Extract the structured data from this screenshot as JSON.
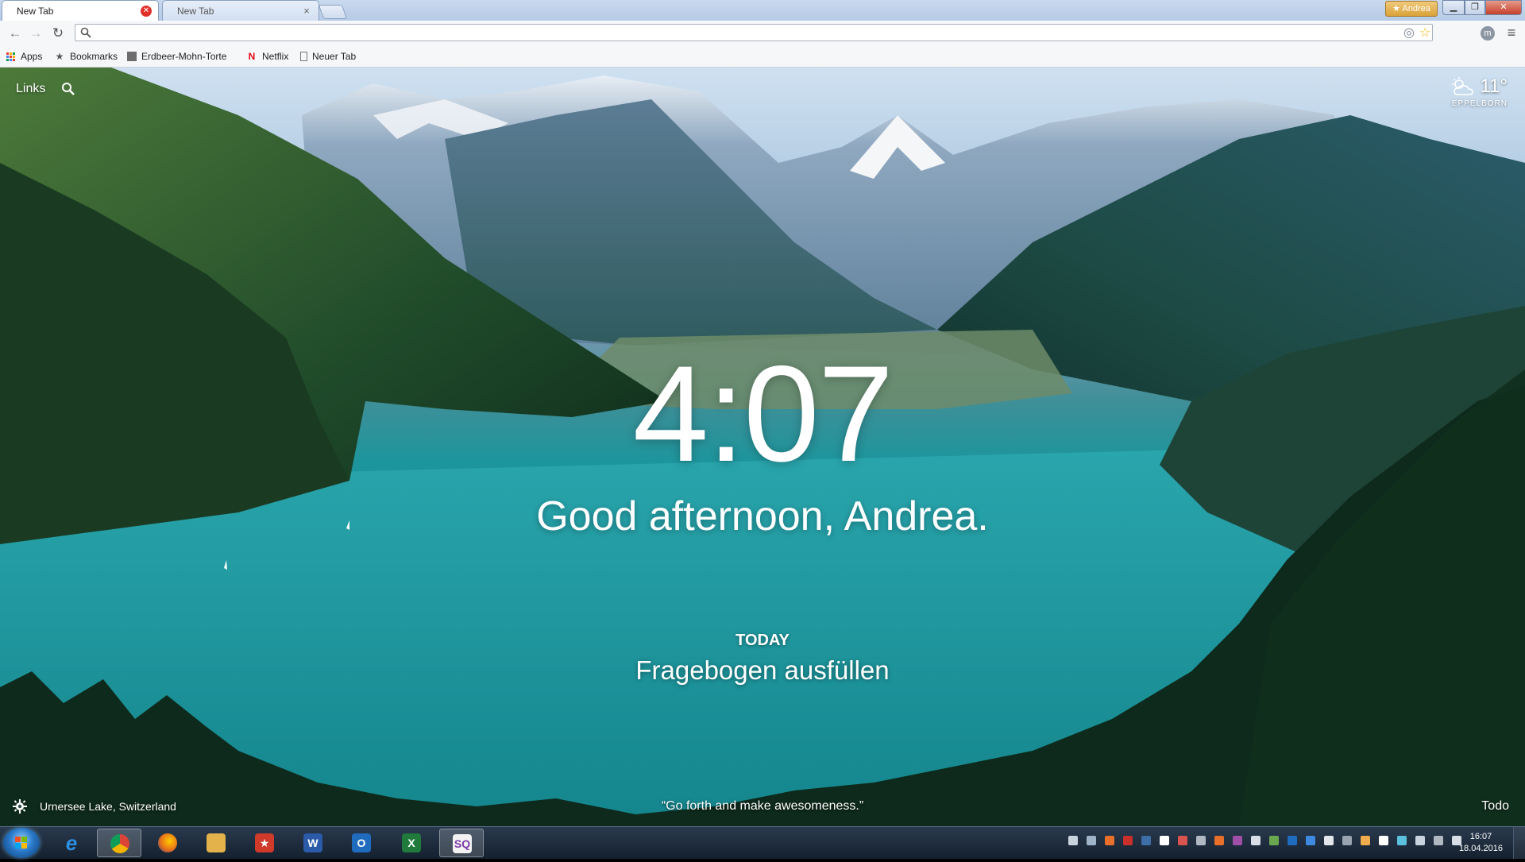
{
  "browser": {
    "tabs": [
      {
        "title": "New Tab",
        "active": true
      },
      {
        "title": "New Tab",
        "active": false
      }
    ],
    "profile_name": "Andrea",
    "omnibox": {
      "value": "",
      "placeholder": ""
    },
    "bookmarks": [
      {
        "label": "Apps",
        "icon": "apps-grid-icon"
      },
      {
        "label": "Bookmarks",
        "icon": "star-icon"
      },
      {
        "label": "Erdbeer-Mohn-Torte",
        "icon": "page-icon"
      },
      {
        "label": "Netflix",
        "icon": "netflix-icon"
      },
      {
        "label": "Neuer Tab",
        "icon": "document-icon"
      }
    ]
  },
  "momentum": {
    "links_label": "Links",
    "weather": {
      "temperature": "11°",
      "location": "EPPELBORN",
      "icon": "partly-cloudy-icon"
    },
    "clock": "4:07",
    "greeting": "Good afternoon, Andrea.",
    "focus_label": "TODAY",
    "focus_text": "Fragebogen ausfüllen",
    "photo_location": "Urnersee Lake, Switzerland",
    "quote": "“Go forth and make awesomeness.”",
    "todo_label": "Todo"
  },
  "taskbar": {
    "apps": [
      {
        "name": "internet-explorer",
        "icon": "ie-icon",
        "color": "#2d8ee0",
        "glyph": "e"
      },
      {
        "name": "chrome",
        "icon": "chrome-icon",
        "color": "#d84a38",
        "glyph": ""
      },
      {
        "name": "firefox",
        "icon": "firefox-icon",
        "color": "#e8701a",
        "glyph": ""
      },
      {
        "name": "file-explorer",
        "icon": "folder-icon",
        "color": "#e3b24a",
        "glyph": ""
      },
      {
        "name": "wunderlist",
        "icon": "wunderlist-icon",
        "color": "#cf3a2a",
        "glyph": "★"
      },
      {
        "name": "word",
        "icon": "word-icon",
        "color": "#2a5aa8",
        "glyph": "W"
      },
      {
        "name": "outlook",
        "icon": "outlook-icon",
        "color": "#1f6cbf",
        "glyph": "O"
      },
      {
        "name": "excel",
        "icon": "excel-icon",
        "color": "#1f7a3c",
        "glyph": "X"
      },
      {
        "name": "sq-app",
        "icon": "sq-icon",
        "color": "#f2f2f2",
        "glyph": "SQ"
      }
    ],
    "time": "16:07",
    "date": "18.04.2016"
  }
}
